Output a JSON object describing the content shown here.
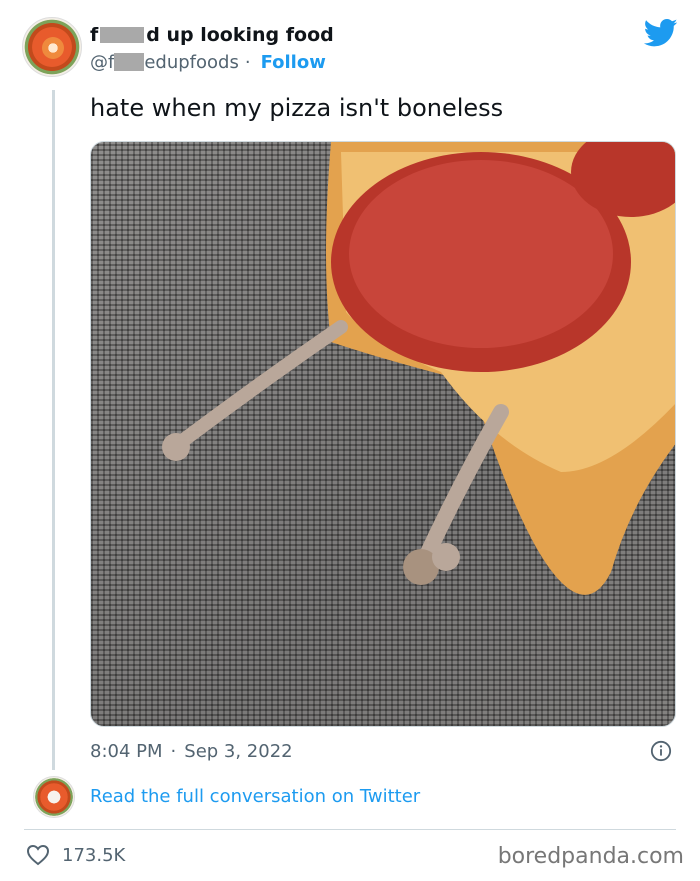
{
  "tweet": {
    "author": {
      "name_prefix": "f",
      "name_suffix": "d up looking food",
      "handle_prefix": "@f",
      "handle_suffix": "edupfoods",
      "separator": "·",
      "follow_label": "Follow"
    },
    "text": "hate when my pizza isn't boneless",
    "time": "8:04 PM",
    "time_separator": "·",
    "date": "Sep 3, 2022",
    "read_full_label": "Read the full conversation on Twitter",
    "likes": "173.5K"
  },
  "watermark": "boredpanda.com",
  "icons": {
    "brand": "twitter-bird-icon",
    "info": "info-icon",
    "like": "heart-icon"
  },
  "colors": {
    "accent": "#1d9bf0",
    "muted": "#536471",
    "text": "#0f1419"
  }
}
